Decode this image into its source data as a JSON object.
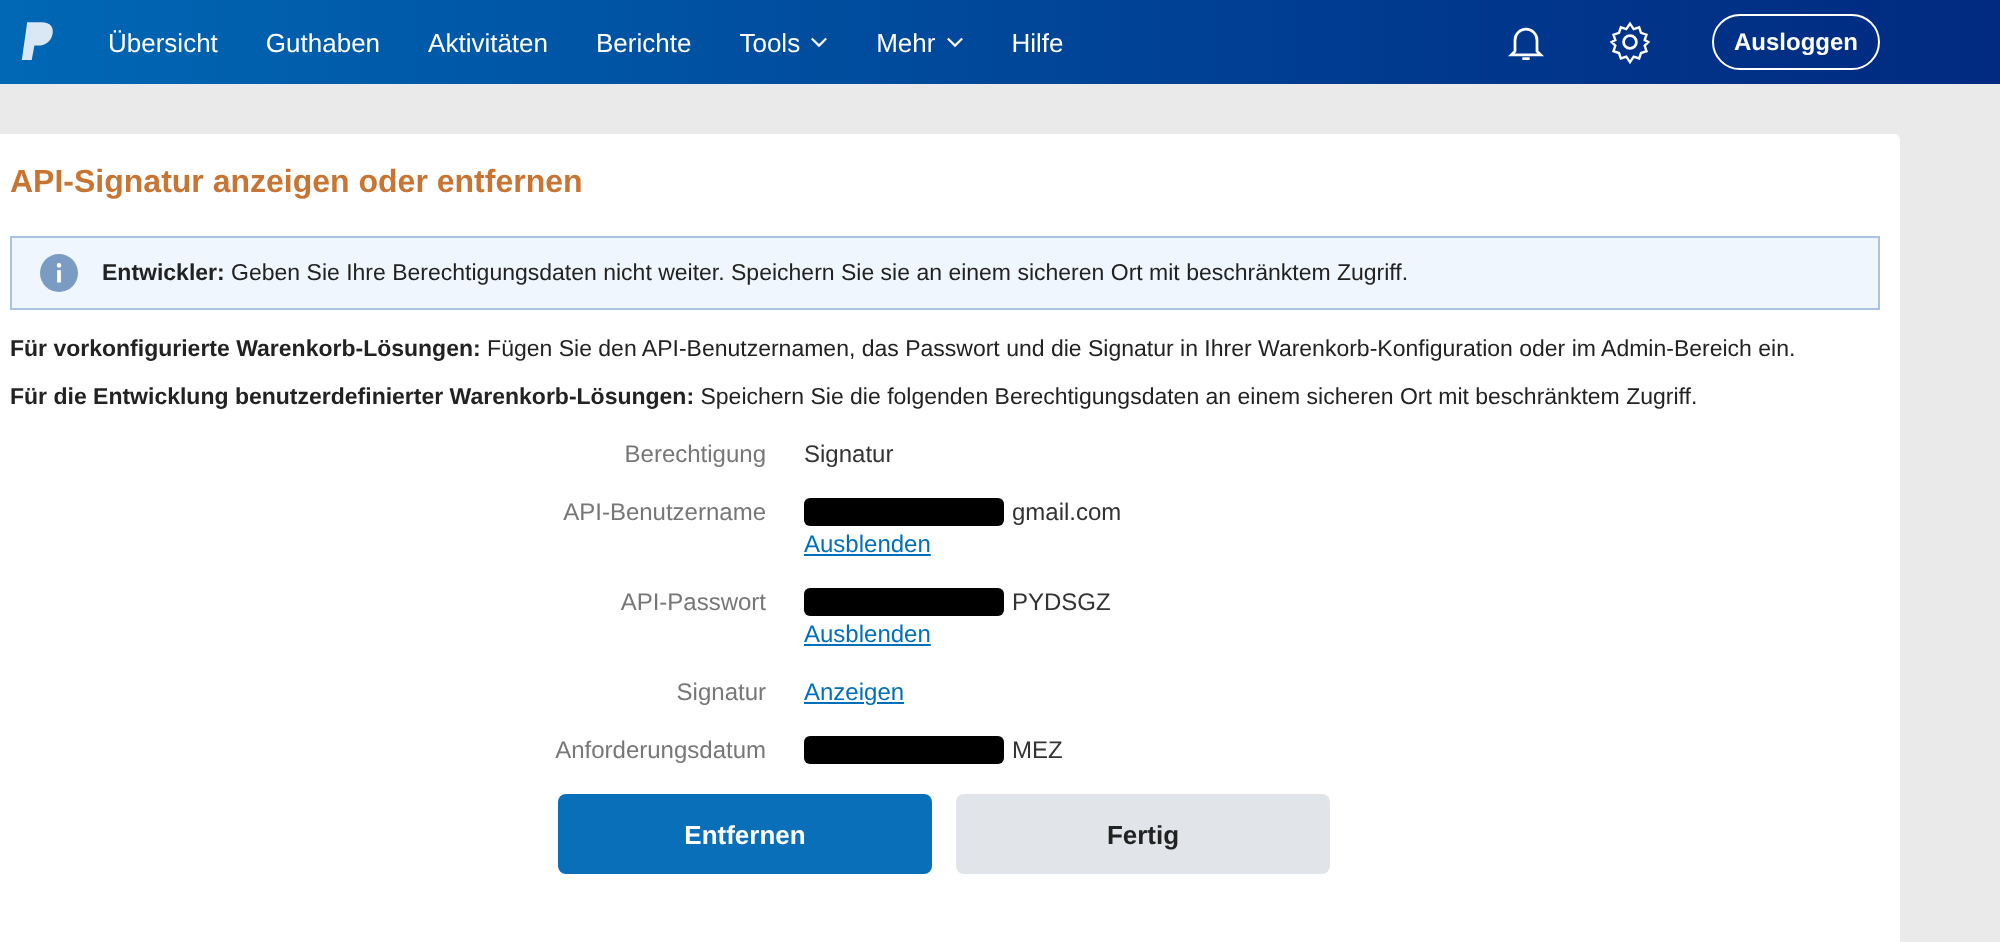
{
  "nav": {
    "items": [
      {
        "label": "Übersicht",
        "has_menu": false
      },
      {
        "label": "Guthaben",
        "has_menu": false
      },
      {
        "label": "Aktivitäten",
        "has_menu": false
      },
      {
        "label": "Berichte",
        "has_menu": false
      },
      {
        "label": "Tools",
        "has_menu": true
      },
      {
        "label": "Mehr",
        "has_menu": true
      },
      {
        "label": "Hilfe",
        "has_menu": false
      }
    ],
    "logout": "Ausloggen"
  },
  "title": "API-Signatur anzeigen oder entfernen",
  "notice": {
    "label": "Entwickler:",
    "text": "Geben Sie Ihre Berechtigungsdaten nicht weiter. Speichern Sie sie an einem sicheren Ort mit beschränktem Zugriff."
  },
  "paragraphs": [
    "**Für vorkonfigurierte Warenkorb-Lösungen:** Fügen Sie den API-Benutzernamen, das Passwort und die Signatur in Ihrer Warenkorb-Konfiguration oder im Admin-Bereich ein.",
    "**Für die Entwicklung benutzerdefinierter Warenkorb-Lösungen:** Speichern Sie die folgenden Berechtigungsdaten an einem sicheren Ort mit beschränktem Zugriff."
  ],
  "credentials": [
    {
      "label": "Berechtigung",
      "value": "Signatur",
      "redacted": false
    },
    {
      "label": "API-Benutzername",
      "value": "gmail.com",
      "redacted": true,
      "link": "Ausblenden"
    },
    {
      "label": "API-Passwort",
      "value": "PYDSGZ",
      "redacted": true,
      "link": "Ausblenden"
    },
    {
      "label": "Signatur",
      "link_inline": "Anzeigen",
      "redacted": false
    },
    {
      "label": "Anforderungsdatum",
      "value": "MEZ",
      "redacted": true
    }
  ],
  "buttons": [
    {
      "label": "Entfernen",
      "kind": "primary"
    },
    {
      "label": "Fertig",
      "kind": "secondary"
    }
  ]
}
